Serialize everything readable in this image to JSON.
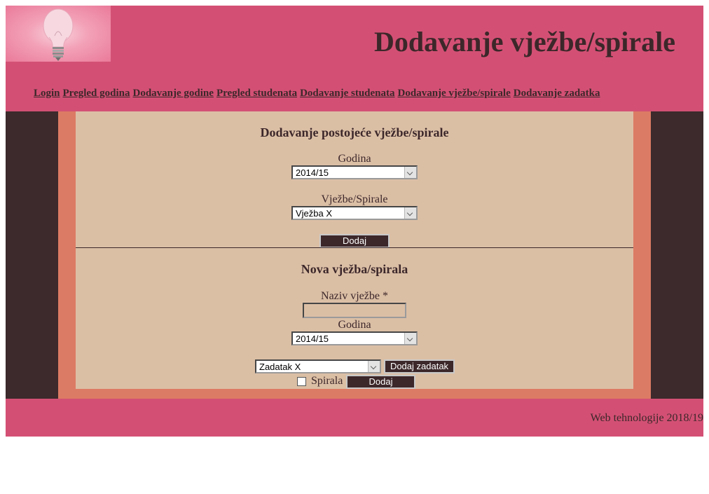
{
  "header": {
    "title": "Dodavanje vježbe/spirale",
    "logo_icon": "lightbulb-icon"
  },
  "nav": {
    "items": [
      {
        "label": "Login"
      },
      {
        "label": "Pregled godina"
      },
      {
        "label": "Dodavanje godine"
      },
      {
        "label": "Pregled studenata"
      },
      {
        "label": "Dodavanje studenata"
      },
      {
        "label": "Dodavanje vježbe/spirale"
      },
      {
        "label": "Dodavanje zadatka"
      }
    ]
  },
  "existing": {
    "title": "Dodavanje postojeće vježbe/spirale",
    "godina_label": "Godina",
    "godina_value": "2014/15",
    "vjezbe_label": "Vježbe/Spirale",
    "vjezbe_value": "Vježba X",
    "add_label": "Dodaj"
  },
  "new": {
    "title": "Nova vježba/spirala",
    "naziv_label": "Naziv vježbe *",
    "naziv_value": "",
    "godina_label": "Godina",
    "godina_value": "2014/15",
    "zadatak_value": "Zadatak X",
    "add_task_label": "Dodaj zadatak",
    "spirala_label": "Spirala",
    "spirala_checked": false,
    "add_label": "Dodaj"
  },
  "footer": {
    "text": "Web tehnologije 2018/19"
  },
  "colors": {
    "header_bg": "#d35074",
    "dark": "#3c272a",
    "frame": "#dc7b65",
    "content_bg": "#dbbfa5"
  }
}
